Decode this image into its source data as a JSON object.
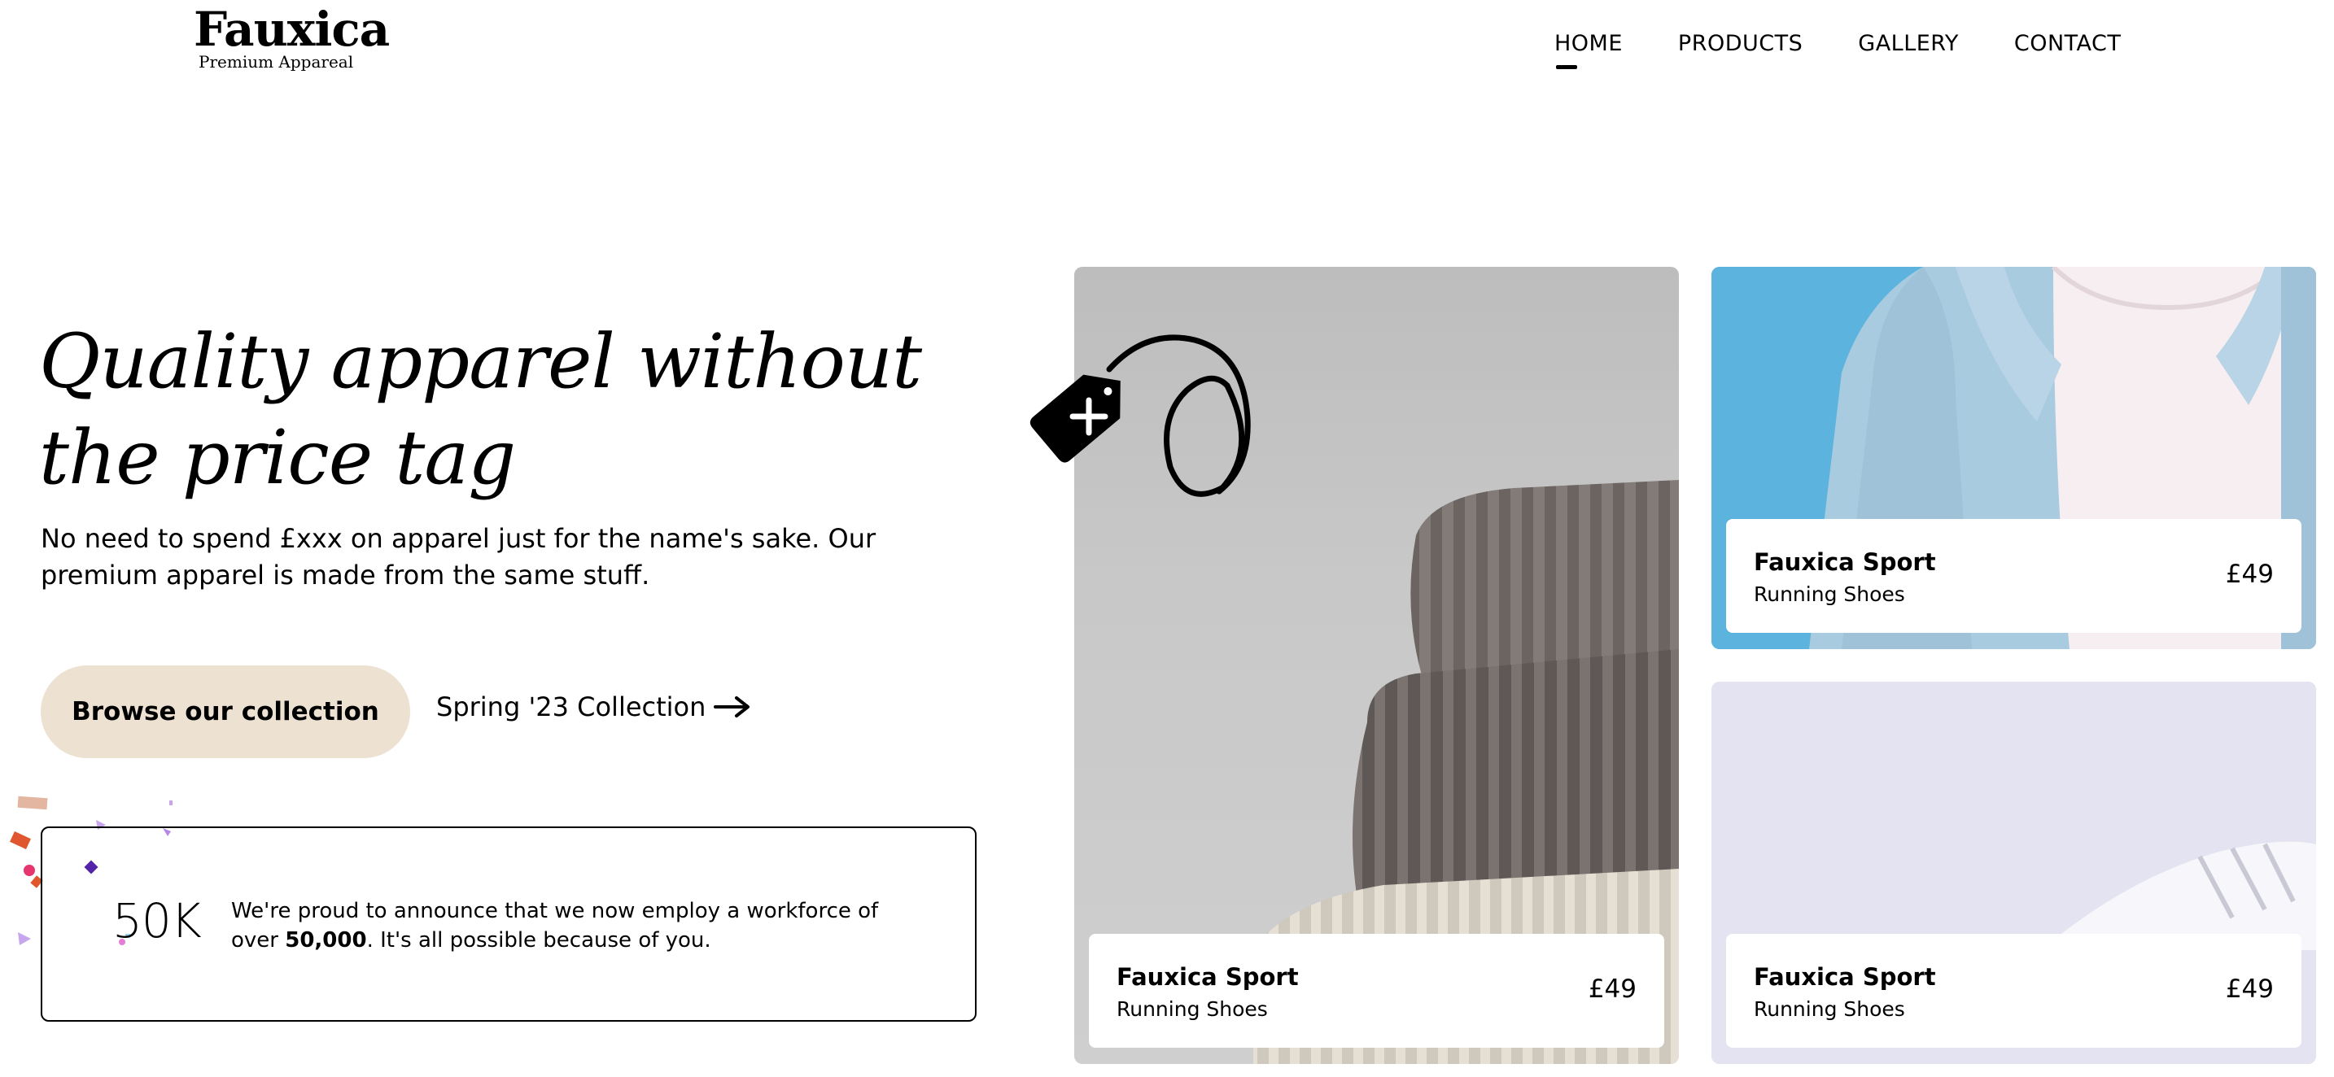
{
  "logo": {
    "title": "Fauxica",
    "subtitle": "Premium Appareal"
  },
  "nav": {
    "home": "HOME",
    "products": "PRODUCTS",
    "gallery": "GALLERY",
    "contact": "CONTACT"
  },
  "hero": {
    "title": "Quality apparel without the price tag",
    "subtitle": "No need to spend £xxx on apparel just for the name's sake. Our premium apparel is made from the same stuff.",
    "browse_label": "Browse our collection",
    "collection_label": "Spring '23 Collection"
  },
  "stat": {
    "number": "50K",
    "text_before": "We're proud to announce that we now employ a workforce of over ",
    "text_bold": "50,000",
    "text_after": ". It's all possible because of you."
  },
  "products": [
    {
      "brand": "Fauxica Sport",
      "name": "Running Shoes",
      "price": "£49"
    },
    {
      "brand": "Fauxica Sport",
      "name": "Running Shoes",
      "price": "£49"
    },
    {
      "brand": "Fauxica Sport",
      "name": "Running Shoes",
      "price": "£49"
    }
  ]
}
